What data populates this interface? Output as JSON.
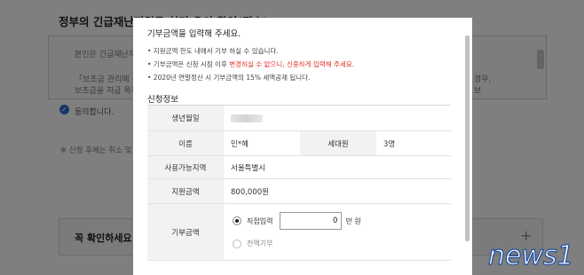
{
  "background": {
    "title": "정부의 긴급재난지원금 처리 유의 확인(필수)",
    "box_line1": "본인은 긴급재난지",
    "box_line2": "「보조금 관리에 관",
    "box_line3": "보조금을 지급 목적",
    "box_right1": "경우,",
    "box_right2": "보",
    "checkbox_label": "동의합니다.",
    "note": "※ 신청 후에는 취소 및 카",
    "confirm_label": "꼭 확인하세요!",
    "confirm_plus": "+"
  },
  "modal": {
    "heading": "기부금액을 입력해 주세요.",
    "bullets": {
      "b1": "• 지원금액 한도 내에서 기부 하실 수 있습니다.",
      "b2_pre": "• 기부금액은 신청 시점 이후 ",
      "b2_red": "변경하실 수 없으니, 신중하게 입력해 주세요.",
      "b3": "• 2020년 연말정산 시 기부금액의 15% 세액공제 됩니다."
    },
    "section_title": "신청정보",
    "rows": {
      "birth_label": "생년월일",
      "name_label": "이름",
      "name_value": "민*혜",
      "household_label": "세대원",
      "household_value": "3명",
      "region_label": "사용가능지역",
      "region_value": "서울특별시",
      "support_label": "지원금액",
      "support_value": "800,000원",
      "donation_label": "기부금액",
      "direct_label": "직접입력",
      "amount_value": "0",
      "unit": "만 원",
      "full_label": "전액기부"
    }
  },
  "watermark": {
    "text": "news1"
  },
  "colors": {
    "accent_red": "#e0322b",
    "check_blue": "#2f6fd1",
    "watermark_blue": "#1e4fa0"
  }
}
